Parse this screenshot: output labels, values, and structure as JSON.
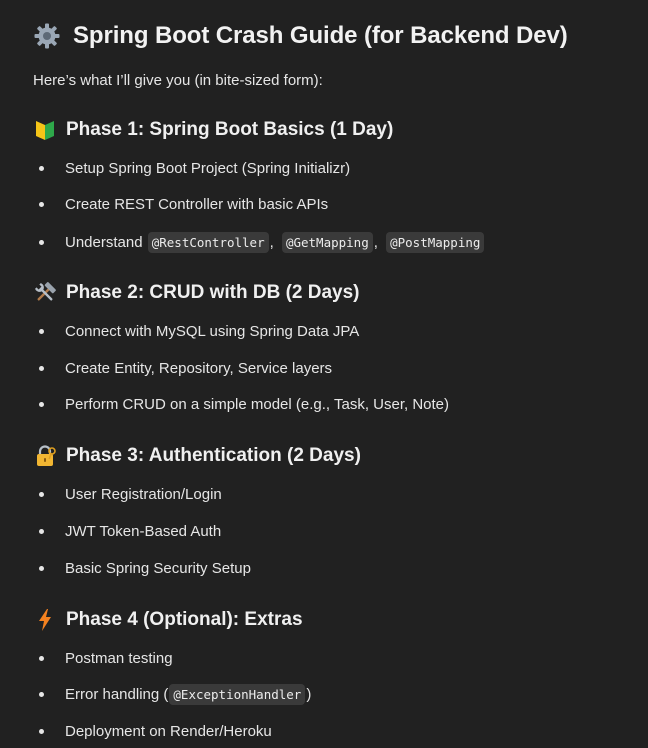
{
  "title": {
    "icon": "gear-icon",
    "text": "Spring Boot Crash Guide (for Backend Dev)"
  },
  "intro": "Here’s what I’ll give you (in bite-sized form):",
  "phases": [
    {
      "icon": "beginner-badge-icon",
      "title": "Phase 1: Spring Boot Basics (1 Day)",
      "items": [
        {
          "text": "Setup Spring Boot Project (Spring Initializr)"
        },
        {
          "text": "Create REST Controller with basic APIs"
        },
        {
          "text": "Understand ",
          "code": [
            "@RestController",
            "@GetMapping",
            "@PostMapping"
          ],
          "separators": [
            ", ",
            ", "
          ]
        }
      ]
    },
    {
      "icon": "hammer-wrench-icon",
      "title": "Phase 2: CRUD with DB (2 Days)",
      "items": [
        {
          "text": "Connect with MySQL using Spring Data JPA"
        },
        {
          "text": "Create Entity, Repository, Service layers"
        },
        {
          "text": "Perform CRUD on a simple model (e.g., Task, User, Note)"
        }
      ]
    },
    {
      "icon": "lock-with-key-icon",
      "title": "Phase 3: Authentication (2 Days)",
      "items": [
        {
          "text": "User Registration/Login"
        },
        {
          "text": "JWT Token-Based Auth"
        },
        {
          "text": "Basic Spring Security Setup"
        }
      ]
    },
    {
      "icon": "lightning-icon",
      "title": "Phase 4 (Optional): Extras",
      "items": [
        {
          "text": "Postman testing"
        },
        {
          "text": "Error handling (",
          "code": [
            "@ExceptionHandler"
          ],
          "after": ")"
        },
        {
          "text": "Deployment on Render/Heroku"
        }
      ]
    }
  ],
  "colors": {
    "background": "#212121",
    "text": "#ececec",
    "code_background": "#3a3a3a"
  }
}
